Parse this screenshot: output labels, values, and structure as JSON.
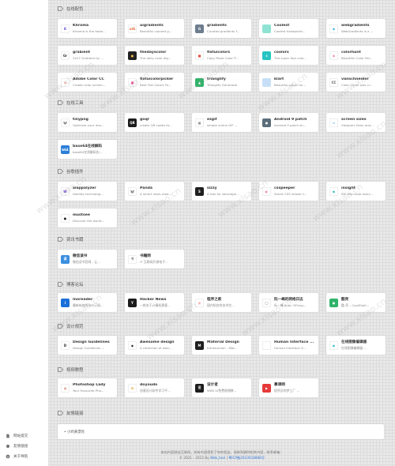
{
  "sidebar": {
    "links": [
      {
        "label": "网站提交",
        "icon": "document-icon"
      },
      {
        "label": "友情链接",
        "icon": "link-icon"
      },
      {
        "label": "关于导航",
        "icon": "info-icon"
      }
    ]
  },
  "categories": [
    {
      "title": "在线配色",
      "items": [
        {
          "title": "Khroma",
          "desc": "Khroma is the faste...",
          "logo_text": "K",
          "logo_color": "#ffffff",
          "logo_fg": "#5b4fd8"
        },
        {
          "title": "uigradients",
          "desc": "Beautiful colored g...",
          "logo_text": "uiG",
          "logo_color": "#ffffff",
          "logo_fg": "#e66a3c"
        },
        {
          "title": "gradients",
          "desc": "Curated gradients f...",
          "logo_text": "G",
          "logo_color": "#6d7d8f",
          "logo_fg": "#ffffff"
        },
        {
          "title": "Coolest",
          "desc": "Coolest handpicke...",
          "logo_text": "",
          "logo_color": "#8fe3d4",
          "logo_fg": "#ffffff"
        },
        {
          "title": "webgradients",
          "desc": "WebGradients is a ...",
          "logo_text": "◆",
          "logo_color": "#ffffff",
          "logo_fg": "#3db1e8"
        },
        {
          "title": "grabient",
          "desc": "2017 Grabient by ...",
          "logo_text": "Gr",
          "logo_color": "#ffffff",
          "logo_fg": "#333333"
        },
        {
          "title": "thedayscolor",
          "desc": "The daily color dig...",
          "logo_text": "●",
          "logo_color": "#222222",
          "logo_fg": "#f5c04a"
        },
        {
          "title": "flatuicolors",
          "desc": "Copy Paste Color P...",
          "logo_text": "■",
          "logo_color": "#ffffff",
          "logo_fg": "#e74c3c"
        },
        {
          "title": "coolors",
          "desc": "The super fast colo...",
          "logo_text": "c",
          "logo_color": "#26c4c2",
          "logo_fg": "#ffffff"
        },
        {
          "title": "colorhunt",
          "desc": "Beautiful Color Pal...",
          "logo_text": "◆",
          "logo_color": "#ffffff",
          "logo_fg": "#f08c9a"
        },
        {
          "title": "Adobe Color CC",
          "desc": "Create color schem...",
          "logo_text": "◎",
          "logo_color": "#ffffff",
          "logo_fg": "#e9564a"
        },
        {
          "title": "flatuicolorpicker",
          "desc": "Best Flat Colors Fo...",
          "logo_text": "■",
          "logo_color": "#ffffff",
          "logo_fg": "#e85b9a"
        },
        {
          "title": "trianglify",
          "desc": "Trianglify Generator",
          "logo_text": "▲",
          "logo_color": "#33b36b",
          "logo_fg": "#ffffff"
        },
        {
          "title": "klart",
          "desc": "Beautiful colors an...",
          "logo_text": "",
          "logo_color": "#c7dff6",
          "logo_fg": "#ffffff"
        },
        {
          "title": "vanschneider",
          "desc": "Color Claim was cr...",
          "logo_text": "CC",
          "logo_color": "#ffffff",
          "logo_fg": "#555555"
        }
      ]
    },
    {
      "title": "在线工具",
      "items": [
        {
          "title": "tinypng",
          "desc": "Optimize your ima...",
          "logo_text": "🐼",
          "logo_color": "#ffffff",
          "logo_fg": "#333333"
        },
        {
          "title": "goqr",
          "desc": "create QR codes fo...",
          "logo_text": "QR",
          "logo_color": "#1c1c1c",
          "logo_fg": "#ffffff"
        },
        {
          "title": "ezgif",
          "desc": "simple online GIF ...",
          "logo_text": "▦",
          "logo_color": "#ffffff",
          "logo_fg": "#666666"
        },
        {
          "title": "Android 9 patch",
          "desc": "Android 9 patch sh...",
          "logo_text": "●",
          "logo_color": "#5b6d7a",
          "logo_fg": "#ffffff"
        },
        {
          "title": "screen sizes",
          "desc": "Viewport Sizes and...",
          "logo_text": "▭",
          "logo_color": "#ffffff",
          "logo_fg": "#3a9de8"
        },
        {
          "title": "base64在线解码",
          "desc": "base64在线解码实...",
          "logo_text": "b64",
          "logo_color": "#2b7fd8",
          "logo_fg": "#ffffff"
        }
      ]
    },
    {
      "title": "谷歌插件",
      "items": [
        {
          "title": "wappalyzer",
          "desc": "Identify technolog...",
          "logo_text": "W",
          "logo_color": "#ffffff",
          "logo_fg": "#6c46c4"
        },
        {
          "title": "Panda",
          "desc": "A smart news read...",
          "logo_text": "🐼",
          "logo_color": "#ffffff",
          "logo_fg": "#333333"
        },
        {
          "title": "sizzy",
          "desc": "A tool for develope...",
          "logo_text": "S",
          "logo_color": "#1f1f1f",
          "logo_fg": "#ffffff"
        },
        {
          "title": "csspeeper",
          "desc": "Smart CSS viewer t...",
          "logo_text": "◐",
          "logo_color": "#ffffff",
          "logo_fg": "#e35a9a"
        },
        {
          "title": "insight",
          "desc": "IDE-like code searc...",
          "logo_text": "◆",
          "logo_color": "#ffffff",
          "logo_fg": "#2db3c8"
        },
        {
          "title": "mustsee",
          "desc": "Discover the world...",
          "logo_text": "●",
          "logo_color": "#ffffff",
          "logo_fg": "#222222"
        }
      ]
    },
    {
      "title": "资讯书籍",
      "items": [
        {
          "title": "微信读书",
          "desc": "微信读书官网 - 让...",
          "logo_text": "读",
          "logo_color": "#3b8fe0",
          "logo_fg": "#ffffff"
        },
        {
          "title": "书籍网",
          "desc": "IT 互联网开源电子...",
          "logo_text": "书",
          "logo_color": "#ffffff",
          "logo_fg": "#888888"
        }
      ]
    },
    {
      "title": "博客论坛",
      "items": [
        {
          "title": "Inoreader",
          "desc": "最新有效的RSS订阅...",
          "logo_text": "i",
          "logo_color": "#1a6fd8",
          "logo_fg": "#ffffff"
        },
        {
          "title": "Hacker News",
          "desc": "一款关于计算机黑客...",
          "logo_text": "Y",
          "logo_color": "#1c1c1c",
          "logo_fg": "#ffffff"
        },
        {
          "title": "程序之家",
          "desc": "国内知名的技术交...",
          "logo_text": "◎",
          "logo_color": "#ffffff",
          "logo_fg": "#e23b3b"
        },
        {
          "title": "阮一峰的网络日志",
          "desc": "阮一峰 Ruan YiFeng...",
          "logo_text": "◯",
          "logo_color": "#ffffff",
          "logo_fg": "#777777"
        },
        {
          "title": "酷壳",
          "desc": "酷 壳 – CoolShell...",
          "logo_text": "●",
          "logo_color": "#2fb36a",
          "logo_fg": "#ffffff"
        }
      ]
    },
    {
      "title": "设计规范",
      "items": [
        {
          "title": "Design Guidelines",
          "desc": "Design Guidelines ...",
          "logo_text": "D",
          "logo_color": "#ffffff",
          "logo_fg": "#222222"
        },
        {
          "title": "Awesome design",
          "desc": "A collection of awe...",
          "logo_text": "◉",
          "logo_color": "#ffffff",
          "logo_fg": "#222222"
        },
        {
          "title": "Material Design",
          "desc": "Introduction - Mat...",
          "logo_text": "M",
          "logo_color": "#1f1f1f",
          "logo_fg": "#ffffff"
        },
        {
          "title": "Human Interface ...",
          "desc": "Human Interface G...",
          "logo_text": "",
          "logo_color": "#ffffff",
          "logo_fg": "#222222"
        },
        {
          "title": "在线图像编辑器",
          "desc": "在线图像编辑器 ...",
          "logo_text": "◉",
          "logo_color": "#ffffff",
          "logo_fg": "#2db3c8"
        }
      ]
    },
    {
      "title": "视频教程",
      "items": [
        {
          "title": "Photoshop Lady",
          "desc": "Your Favourite Pho...",
          "logo_text": "◍",
          "logo_color": "#ffffff",
          "logo_fg": "#c05a3a"
        },
        {
          "title": "doyoudo",
          "desc": "创意设计软件学习平...",
          "logo_text": "✿",
          "logo_color": "#ffffff",
          "logo_fg": "#e89a2a"
        },
        {
          "title": "设计者",
          "desc": "WEB UI免费视频教...",
          "logo_text": "设",
          "logo_color": "#1c1c1c",
          "logo_fg": "#ffffff"
        },
        {
          "title": "慕课网",
          "desc": "程序员的梦工厂 ...",
          "logo_text": "▶",
          "logo_color": "#e63a3a",
          "logo_fg": "#ffffff"
        }
      ]
    }
  ],
  "links_section": {
    "title": "友情链接",
    "link": "• 小鸡黄漂亮"
  },
  "footer": {
    "line1": "本站内容源自互联网，如有内容侵犯了你的权益，请联系删除相关内容，联系邮箱：",
    "line2_prefix": "© 2021 - 2023 By",
    "line2_link": "Web_tool",
    "line2_sep": " | ",
    "line2_icp": "粤ICP备2023018888号"
  },
  "watermark": "www.xlsao.cn"
}
